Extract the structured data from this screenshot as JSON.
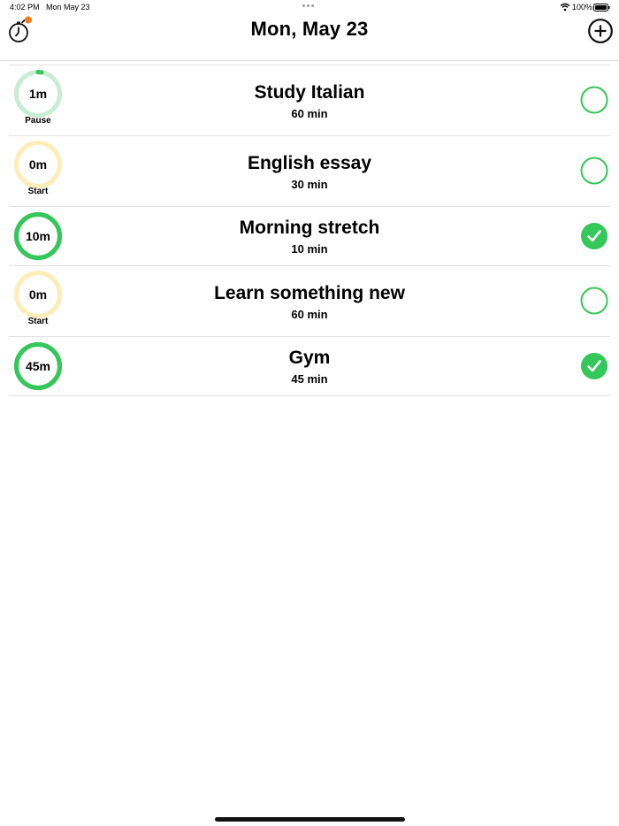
{
  "status": {
    "time": "4:02 PM",
    "date": "Mon May 23",
    "battery": "100%"
  },
  "header": {
    "title": "Mon, May 23",
    "left_icon": "stopwatch-icon",
    "right_icon": "plus-circle-icon",
    "badge_color": "#f07c1c"
  },
  "colors": {
    "green": "#34c759",
    "light_green": "#c9ecd2",
    "yellow": "#fdeeb8",
    "gray_line": "#e3e3e3"
  },
  "tasks": [
    {
      "name": "Study Italian",
      "duration": "60 min",
      "elapsed": "1m",
      "action": "Pause",
      "progress": 0.0167,
      "ring_color": "#c9ecd2",
      "completed": false
    },
    {
      "name": "English essay",
      "duration": "30 min",
      "elapsed": "0m",
      "action": "Start",
      "progress": 0,
      "ring_color": "#fdeeb8",
      "completed": false
    },
    {
      "name": "Morning stretch",
      "duration": "10 min",
      "elapsed": "10m",
      "action": "",
      "progress": 1,
      "ring_color": "#34c759",
      "completed": true
    },
    {
      "name": "Learn something new",
      "duration": "60 min",
      "elapsed": "0m",
      "action": "Start",
      "progress": 0,
      "ring_color": "#fdeeb8",
      "completed": false
    },
    {
      "name": "Gym",
      "duration": "45 min",
      "elapsed": "45m",
      "action": "",
      "progress": 1,
      "ring_color": "#34c759",
      "completed": true
    }
  ]
}
